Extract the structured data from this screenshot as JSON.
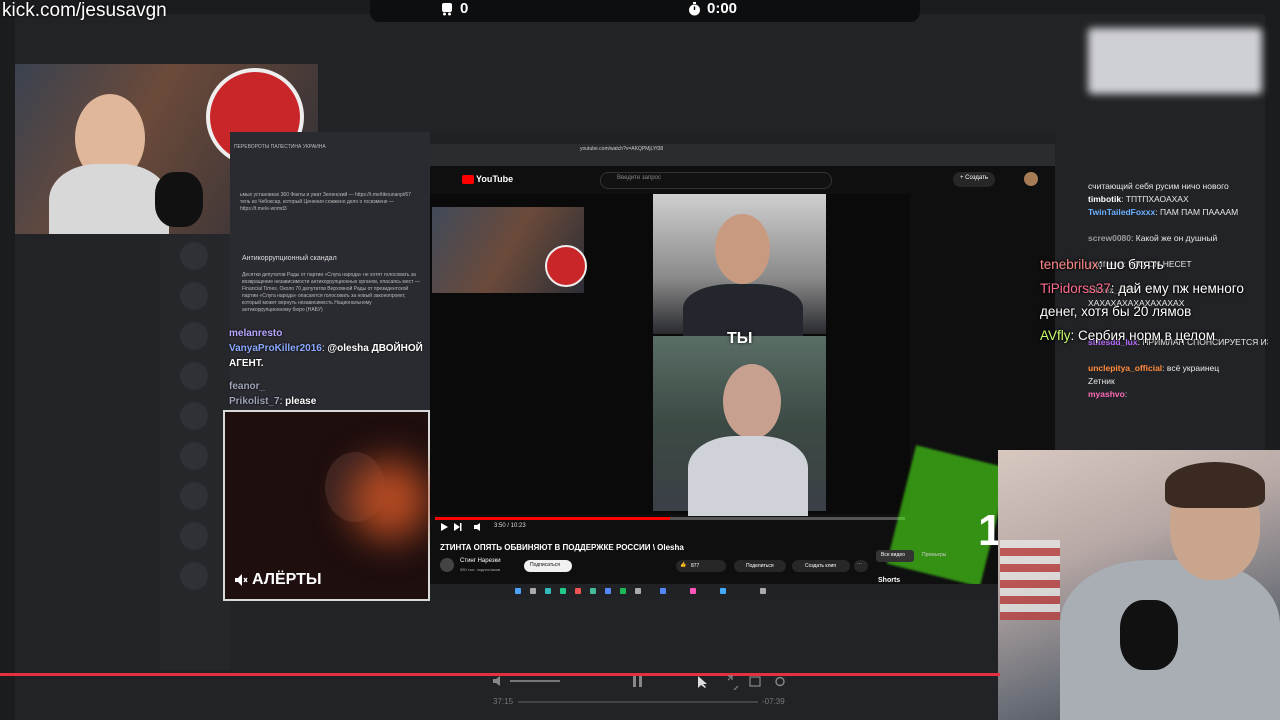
{
  "top": {
    "url": "kick.com/jesusavgn",
    "viewers": "0",
    "timer": "0:00"
  },
  "tg": {
    "title": "ПЕРЕВОРОТЫ ПАЛЕСТИНА УКРАИНА",
    "text1": "ьмых установках 360 Факты и ужат Зеленский — https://t.me/tikounanpi/67 тель из Чебоксар, который Ценения сожжено дело о госизмене — https://t.me/e-wnmd3",
    "heading": "Антикоррупционный скандал",
    "text2": "Десятки депутатов Рады от партии «Слуга народа» не хотят голосовать за возвращение независимости антикоррупционных органов, опасаясь мест — Financial Times. Около 70 депутатов Верховной Рады от президентской партии «Слуга народа» опасаются голосовать за новый законопроект, который может вернуть независимость Национальному антикоррупционному бюро (НАБУ)"
  },
  "left_chat": [
    {
      "user": "melanresto",
      "text": ""
    },
    {
      "user": "VanyaProKiller2016",
      "text": "@olesha ДВОЙНОЙ АГЕНТ."
    },
    {
      "user": "feanor_",
      "text": ""
    },
    {
      "user": "Prikolist_7",
      "text": "please"
    }
  ],
  "alerts": {
    "label": "АЛЁРТЫ"
  },
  "browser": {
    "url": "youtube.com/watch?v=AKQPMjLYf38",
    "youtube_logo": "YouTube",
    "search_placeholder": "Введите запрос",
    "create_label": "+ Создать",
    "video_overlay_text": "ТЫ",
    "video_time": "3:50 / 10:23",
    "video_title": "ZТИНТА ОПЯТЬ ОБВИНЯЮТ В ПОДДЕРЖКЕ РОССИИ \\ Olesha",
    "channel_name": "Стинг Нарезки",
    "channel_subs": "550 тыс. подписчиков",
    "subscribe_label": "Подписаться",
    "likes": "877",
    "share_label": "Поделиться",
    "clip_label": "Создать клип",
    "all_videos_label": "Все видео",
    "premieres_label": "Премьеры",
    "shorts_label": "Shorts",
    "one_digit": "1"
  },
  "right_chat_small": [
    {
      "user": "",
      "text": "считающий себя русим ничо нового"
    },
    {
      "user": "timbotik",
      "text": ": ТПТПХАОАХАХ"
    },
    {
      "user": "TwinTailedFoxxx",
      "text": ": ПАМ ПАМ ПААААМ"
    },
    {
      "user": "screw0080",
      "text": ": Какой же он душный"
    },
    {
      "user": "sadfreed",
      "text": ": ЧТО ОН НЕСЕТ"
    },
    {
      "user": "sadfreed",
      "text": ""
    },
    {
      "user": "xilixez_s37",
      "text": ":"
    },
    {
      "user": "",
      "text": "ХАХАХАХАХАХАХАХАХ"
    },
    {
      "user": "",
      "text": ""
    },
    {
      "user": "stitesdd_lux",
      "text": ": ПРИМЛАН СПОНСИРУЕТСЯ ИЗ РОССИИ"
    },
    {
      "user": "unclepitya_official",
      "text": ": всё украинец"
    },
    {
      "user": "",
      "text": "Zетник"
    },
    {
      "user": "myashvo",
      "text": ":"
    }
  ],
  "overlay_chat": [
    {
      "user": "tenebrilux",
      "text": ": шо блять",
      "color": "#ff8a8a"
    },
    {
      "user": "TiPidorss37",
      "text": ": дай ему пж немного денег, хотя бы 20 лямов",
      "color": "#ff6e8e"
    },
    {
      "user": "AVfly",
      "text": ": Сербия норм в целом",
      "color": "#c8ff6e"
    }
  ],
  "player": {
    "time_elapsed": "37:15",
    "time_remaining": "-07:39"
  },
  "colors": {
    "kick_green": "#53fc18",
    "youtube_red": "#ff0000",
    "player_red": "#e5303f"
  }
}
